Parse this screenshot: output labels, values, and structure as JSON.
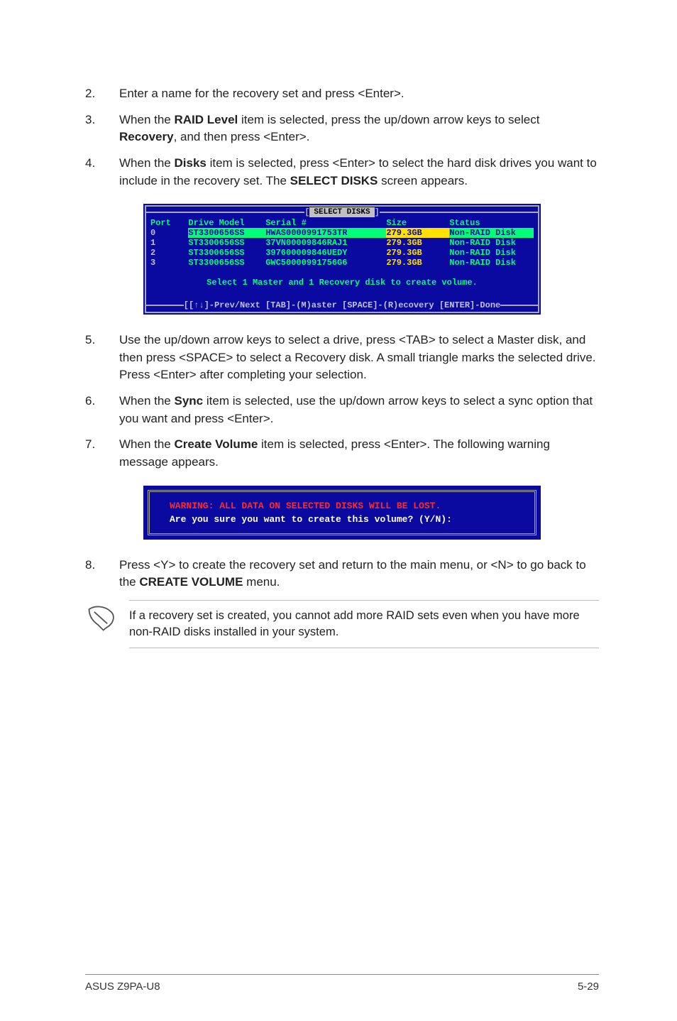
{
  "steps_a": [
    {
      "n": "2.",
      "html": "Enter a name for the recovery set and press <Enter>."
    },
    {
      "n": "3.",
      "html": "When the {b}RAID Level{/b} item is selected, press the up/down arrow keys to select {b}Recovery{/b}, and then press <Enter>."
    },
    {
      "n": "4.",
      "html": "When the {b}Disks{/b} item is selected, press <Enter> to select the hard disk drives you want to include in the recovery set. The {b}SELECT DISKS{/b} screen appears."
    }
  ],
  "bios": {
    "title": "SELECT DISKS",
    "headers": {
      "port": "Port",
      "model": "Drive Model",
      "serial": "Serial #",
      "size": "Size",
      "status": "Status"
    },
    "rows": [
      {
        "port": "0",
        "model": "ST3300656SS",
        "serial": "HWAS0000991753TR",
        "size": "279.3GB",
        "status": "Non-RAID Disk",
        "selected": true
      },
      {
        "port": "1",
        "model": "ST3300656SS",
        "serial": "37VN00009846RAJ1",
        "size": "279.3GB",
        "status": "Non-RAID Disk",
        "selected": false
      },
      {
        "port": "2",
        "model": "ST3300656SS",
        "serial": "397600009846UEDY",
        "size": "279.3GB",
        "status": "Non-RAID Disk",
        "selected": false
      },
      {
        "port": "3",
        "model": "ST3300656SS",
        "serial": "GWC50000991756G6",
        "size": "279.3GB",
        "status": "Non-RAID Disk",
        "selected": false
      }
    ],
    "message": "Select 1 Master and 1 Recovery disk to create volume.",
    "footer": "[[↑↓]-Prev/Next [TAB]-(M)aster [SPACE]-(R)ecovery [ENTER]-Done"
  },
  "steps_b": [
    {
      "n": "5.",
      "html": "Use the up/down arrow keys to select a drive, press <TAB> to select a Master disk, and then press <SPACE> to select a Recovery disk. A small triangle marks the selected drive. Press <Enter> after completing your selection."
    },
    {
      "n": "6.",
      "html": "When the {b}Sync{/b} item is selected, use the up/down arrow keys to select a sync option that you want and press <Enter>."
    },
    {
      "n": "7.",
      "html": "When the {b}Create Volume{/b} item is selected, press <Enter>. The following warning message appears."
    }
  ],
  "warning": {
    "line1": "WARNING: ALL DATA ON SELECTED DISKS WILL BE LOST.",
    "line2": "Are you sure you want to create this volume? (Y/N):"
  },
  "steps_c": [
    {
      "n": "8.",
      "html": "Press <Y> to create the recovery set and return to the main menu, or <N> to go back to the {b}CREATE VOLUME{/b} menu."
    }
  ],
  "note": "If a recovery set is created, you cannot add more RAID sets even when you have more non-RAID disks installed in your system.",
  "footer": {
    "left": "ASUS Z9PA-U8",
    "right": "5-29"
  }
}
